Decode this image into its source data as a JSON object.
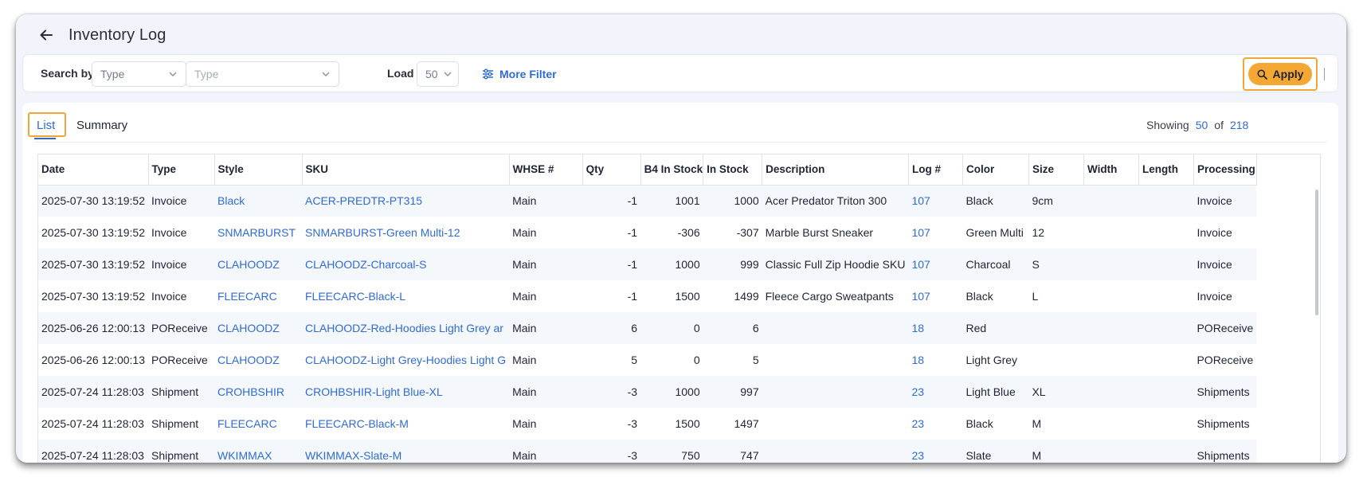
{
  "header": {
    "title": "Inventory Log"
  },
  "filters": {
    "search_label": "Search by",
    "type1_value": "Type",
    "type2_placeholder": "Type",
    "load_label": "Load",
    "load_value": "50",
    "more_filter_label": "More Filter",
    "apply_label": "Apply"
  },
  "tabs": {
    "list": "List",
    "summary": "Summary"
  },
  "pagination": {
    "showing_label": "Showing",
    "shown": "50",
    "of_label": "of",
    "total": "218"
  },
  "colors": {
    "accent": "#f5a733",
    "link": "#2f6bd6",
    "highlight_frame": "#f2a638"
  },
  "table": {
    "columns": [
      "Date",
      "Type",
      "Style",
      "SKU",
      "WHSE #",
      "Qty",
      "B4 In Stock",
      "In Stock",
      "Description",
      "Log #",
      "Color",
      "Size",
      "Width",
      "Length",
      "Processing"
    ],
    "rows": [
      [
        "2025-07-30 13:19:52",
        "Invoice",
        "Black",
        "ACER-PREDTR-PT315",
        "Main",
        "-1",
        "1001",
        "1000",
        "Acer Predator Triton 300",
        "107",
        "Black",
        "9cm",
        "",
        "",
        "Invoice"
      ],
      [
        "2025-07-30 13:19:52",
        "Invoice",
        "SNMARBURST",
        "SNMARBURST-Green Multi-12",
        "Main",
        "-1",
        "-306",
        "-307",
        "Marble Burst Sneaker",
        "107",
        "Green Multi",
        "12",
        "",
        "",
        "Invoice"
      ],
      [
        "2025-07-30 13:19:52",
        "Invoice",
        "CLAHOODZ",
        "CLAHOODZ-Charcoal-S",
        "Main",
        "-1",
        "1000",
        "999",
        "Classic Full Zip Hoodie SKU",
        "107",
        "Charcoal",
        "S",
        "",
        "",
        "Invoice"
      ],
      [
        "2025-07-30 13:19:52",
        "Invoice",
        "FLEECARC",
        "FLEECARC-Black-L",
        "Main",
        "-1",
        "1500",
        "1499",
        "Fleece Cargo Sweatpants",
        "107",
        "Black",
        "L",
        "",
        "",
        "Invoice"
      ],
      [
        "2025-06-26 12:00:13",
        "POReceive",
        "CLAHOODZ",
        "CLAHOODZ-Red-Hoodies Light Grey ar",
        "Main",
        "6",
        "0",
        "6",
        "",
        "18",
        "Red",
        "",
        "",
        "",
        "POReceive"
      ],
      [
        "2025-06-26 12:00:13",
        "POReceive",
        "CLAHOODZ",
        "CLAHOODZ-Light Grey-Hoodies Light G",
        "Main",
        "5",
        "0",
        "5",
        "",
        "18",
        "Light Grey",
        "",
        "",
        "",
        "POReceive"
      ],
      [
        "2025-07-24 11:28:03",
        "Shipment",
        "CROHBSHIR",
        "CROHBSHIR-Light Blue-XL",
        "Main",
        "-3",
        "1000",
        "997",
        "",
        "23",
        "Light Blue",
        "XL",
        "",
        "",
        "Shipments"
      ],
      [
        "2025-07-24 11:28:03",
        "Shipment",
        "FLEECARC",
        "FLEECARC-Black-M",
        "Main",
        "-3",
        "1500",
        "1497",
        "",
        "23",
        "Black",
        "M",
        "",
        "",
        "Shipments"
      ],
      [
        "2025-07-24 11:28:03",
        "Shipment",
        "WKIMMAX",
        "WKIMMAX-Slate-M",
        "Main",
        "-3",
        "750",
        "747",
        "",
        "23",
        "Slate",
        "M",
        "",
        "",
        "Shipments"
      ]
    ]
  }
}
